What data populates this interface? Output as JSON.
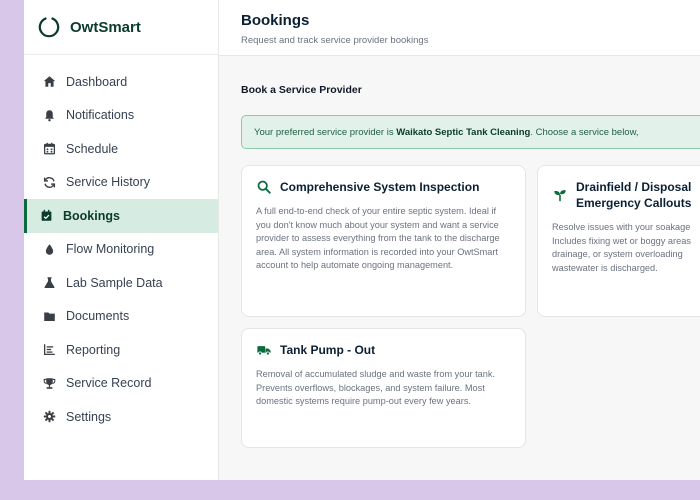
{
  "brand": {
    "name": "OwtSmart"
  },
  "sidebar": {
    "items": [
      {
        "label": "Dashboard",
        "icon": "home-icon"
      },
      {
        "label": "Notifications",
        "icon": "bell-icon"
      },
      {
        "label": "Schedule",
        "icon": "calendar-icon"
      },
      {
        "label": "Service History",
        "icon": "refresh-icon"
      },
      {
        "label": "Bookings",
        "icon": "calendar-check-icon",
        "active": true
      },
      {
        "label": "Flow Monitoring",
        "icon": "droplet-icon"
      },
      {
        "label": "Lab Sample Data",
        "icon": "flask-icon"
      },
      {
        "label": "Documents",
        "icon": "folder-icon"
      },
      {
        "label": "Reporting",
        "icon": "chart-icon"
      },
      {
        "label": "Service Record",
        "icon": "trophy-icon"
      },
      {
        "label": "Settings",
        "icon": "gear-icon"
      }
    ]
  },
  "header": {
    "title": "Bookings",
    "subtitle": "Request and track service provider bookings"
  },
  "section": {
    "title": "Book a Service Provider"
  },
  "banner": {
    "prefix": "Your preferred service provider is ",
    "provider": "Waikato Septic Tank Cleaning",
    "suffix": ". Choose a service below, "
  },
  "cards": [
    {
      "title": "Comprehensive System Inspection",
      "icon": "search-icon",
      "description": "A full end-to-end check of your entire septic system. Ideal if you don't know much about your system and want a service provider to assess everything from the tank to the discharge area. All system information is recorded into your OwtSmart account to help automate ongoing management."
    },
    {
      "title": "Drainfield / Disposal Emergency Callouts",
      "icon": "sprout-icon",
      "description": "Resolve issues with your soakage Includes fixing wet or boggy areas drainage, or system overloading wastewater is discharged."
    },
    {
      "title": "Tank Pump - Out",
      "icon": "truck-icon",
      "description": "Removal of accumulated sludge and waste from your tank. Prevents overflows, blockages, and system failure. Most domestic systems require pump-out every few years."
    }
  ],
  "colors": {
    "accent": "#0b6b3f",
    "active_bg": "#d6ece2",
    "banner_bg": "#e2f2ea",
    "outer_bg": "#d8c7e8"
  }
}
